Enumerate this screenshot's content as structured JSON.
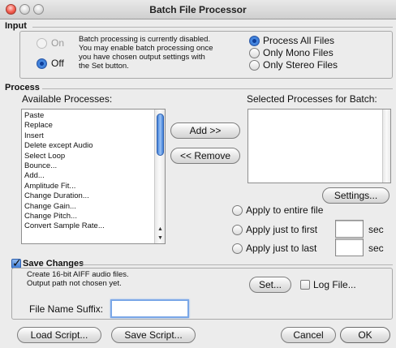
{
  "window": {
    "title": "Batch File Processor"
  },
  "input": {
    "group_label": "Input",
    "on_label": "On",
    "off_label": "Off",
    "message": "Batch processing is currently disabled.\nYou may enable batch processing once\nyou have chosen output settings with\nthe Set button.",
    "file_options": [
      "Process All Files",
      "Only Mono Files",
      "Only Stereo Files"
    ],
    "selected_file_option": "Process All Files",
    "batch_state": "Off"
  },
  "process": {
    "group_label": "Process",
    "available_label": "Available Processes:",
    "selected_label": "Selected Processes for Batch:",
    "available_items": [
      "Paste",
      "Replace",
      "Insert",
      "Delete except Audio",
      "Select Loop",
      "Bounce...",
      "Add...",
      "Amplitude Fit...",
      "Change Duration...",
      "Change Gain...",
      "Change Pitch...",
      "Convert Sample Rate..."
    ],
    "selected_items": [],
    "add_label": "Add >>",
    "remove_label": "<< Remove",
    "settings_label": "Settings...",
    "apply_entire": "Apply to entire file",
    "apply_first": "Apply just to first",
    "apply_last": "Apply just to last",
    "sec_unit": "sec",
    "first_value": "",
    "last_value": ""
  },
  "save": {
    "checkbox_label": "Save Changes",
    "checked": true,
    "description": "Create 16-bit AIFF audio files.\nOutput path not chosen yet.",
    "set_label": "Set...",
    "log_label": "Log File...",
    "log_checked": false,
    "suffix_label": "File Name Suffix:",
    "suffix_value": ""
  },
  "footer": {
    "load_label": "Load Script...",
    "save_label": "Save Script...",
    "cancel_label": "Cancel",
    "ok_label": "OK"
  }
}
